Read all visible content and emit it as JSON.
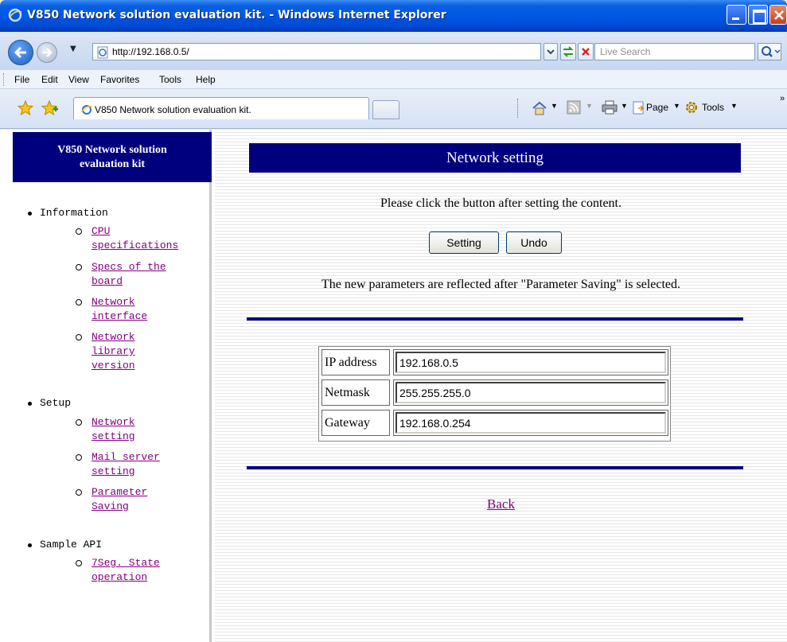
{
  "window": {
    "title": "V850 Network solution evaluation kit. - Windows Internet Explorer"
  },
  "address_bar": {
    "url": "http://192.168.0.5/",
    "search_placeholder": "Live Search"
  },
  "menu": [
    "File",
    "Edit",
    "View",
    "Favorites",
    "Tools",
    "Help"
  ],
  "tab": {
    "label": "V850 Network solution evaluation kit."
  },
  "command_bar": {
    "page_label": "Page",
    "tools_label": "Tools"
  },
  "sidebar": {
    "header_line1": "V850 Network solution",
    "header_line2": "evaluation kit",
    "sections": [
      {
        "label": "Information",
        "links": [
          "CPU\nspecifications",
          "Specs of the\nboard",
          "Network\ninterface",
          "Network\nlibrary\nversion"
        ]
      },
      {
        "label": "Setup",
        "links": [
          "Network\nsetting",
          "Mail server\nsetting",
          "Parameter\nSaving"
        ]
      },
      {
        "label": "Sample API",
        "links": [
          "7Seg. State\noperation"
        ]
      }
    ]
  },
  "main": {
    "banner": "Network setting",
    "instruction": "Please click the button after setting the content.",
    "setting_button": "Setting",
    "undo_button": "Undo",
    "note": "The new parameters are reflected after \"Parameter Saving\" is selected.",
    "fields": [
      {
        "label": "IP address",
        "value": "192.168.0.5"
      },
      {
        "label": "Netmask",
        "value": "255.255.255.0"
      },
      {
        "label": "Gateway",
        "value": "192.168.0.254"
      }
    ],
    "back_link": "Back"
  },
  "colors": {
    "navy": "#00007f",
    "visited_link": "#800080",
    "xp_titlebar": "#0058e6"
  }
}
